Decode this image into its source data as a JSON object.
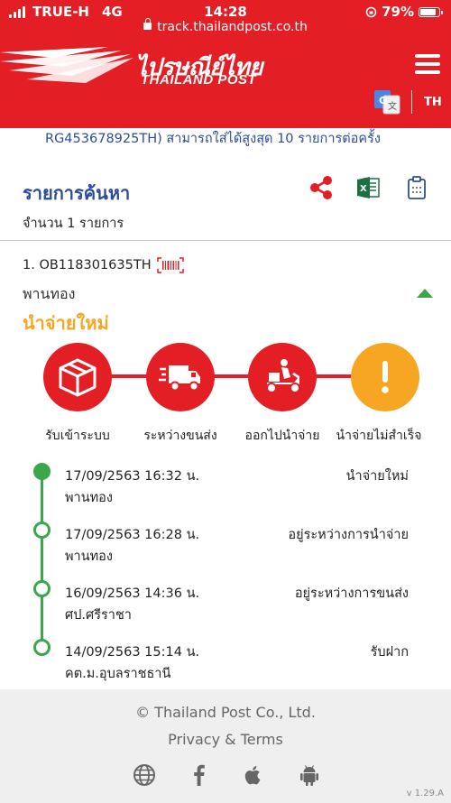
{
  "status_bar": {
    "carrier": "TRUE-H",
    "network": "4G",
    "time": "14:28",
    "battery": "79%"
  },
  "browser": {
    "url": "track.thailandpost.co.th"
  },
  "header": {
    "logo_th": "ไปรษณีย์ไทย",
    "logo_en": "THAILAND POST",
    "lang": "TH"
  },
  "note": "RG453678925TH) สามารถใส่ได้สูงสุด 10 รายการต่อครั้ง",
  "search": {
    "title": "รายการค้นหา",
    "count": "จำนวน 1 รายการ"
  },
  "item": {
    "tracking": "1. OB118301635TH",
    "branch": "พานทอง",
    "status": "นำจ่ายใหม่"
  },
  "steps": [
    {
      "label": "รับเข้าระบบ",
      "icon": "box-icon",
      "color": "#e31e24"
    },
    {
      "label": "ระหว่างขนส่ง",
      "icon": "truck-icon",
      "color": "#e31e24"
    },
    {
      "label": "ออกไปนำจ่าย",
      "icon": "scooter-icon",
      "color": "#e31e24"
    },
    {
      "label": "นำจ่ายไม่สำเร็จ",
      "icon": "exclamation-icon",
      "color": "#f6a623"
    }
  ],
  "timeline": [
    {
      "datetime": "17/09/2563 16:32 น.",
      "status": "นำจ่ายใหม่",
      "place": "พานทอง"
    },
    {
      "datetime": "17/09/2563 16:28 น.",
      "status": "อยู่ระหว่างการนำจ่าย",
      "place": "พานทอง"
    },
    {
      "datetime": "16/09/2563 14:36 น.",
      "status": "อยู่ระหว่างการขนส่ง",
      "place": "ศป.ศรีราชา"
    },
    {
      "datetime": "14/09/2563 15:14 น.",
      "status": "รับฝาก",
      "place": "คต.ม.อุบลราชธานี"
    }
  ],
  "footer": {
    "copyright": "© Thailand Post Co., Ltd.",
    "privacy": "Privacy & Terms",
    "version": "v 1.29.A"
  },
  "colors": {
    "brand_red": "#e31e24",
    "accent_blue": "#2b4c9a",
    "status_orange": "#f6a623",
    "timeline_green": "#3aa84a"
  }
}
